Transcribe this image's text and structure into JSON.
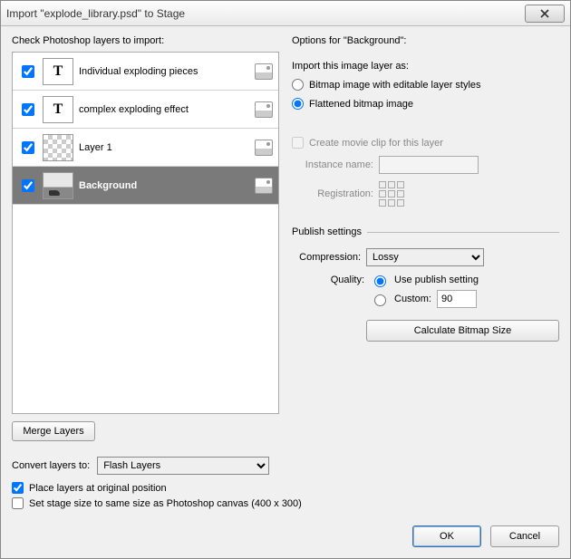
{
  "titlebar": {
    "title": "Import \"explode_library.psd\" to Stage"
  },
  "left": {
    "heading": "Check Photoshop layers to import:",
    "merge_label": "Merge Layers",
    "layers": [
      {
        "name": "Individual exploding pieces"
      },
      {
        "name": "complex exploding effect"
      },
      {
        "name": "Layer 1"
      },
      {
        "name": "Background"
      }
    ]
  },
  "right": {
    "heading": "Options for \"Background\":",
    "import_as_label": "Import this image layer as:",
    "radio_bitmap": "Bitmap image with editable layer styles",
    "radio_flattened": "Flattened bitmap image",
    "create_movieclip": "Create movie clip for this layer",
    "instance_label": "Instance name:",
    "registration_label": "Registration:",
    "publish_heading": "Publish settings",
    "compression_label": "Compression:",
    "compression_value": "Lossy",
    "quality_label": "Quality:",
    "quality_publish": "Use publish setting",
    "quality_custom": "Custom:",
    "quality_value": "90",
    "calc_button": "Calculate Bitmap Size"
  },
  "footer": {
    "convert_label": "Convert layers to:",
    "convert_value": "Flash Layers",
    "place_original": "Place layers at original position",
    "stage_size": "Set stage size to same size as Photoshop canvas (400 x 300)",
    "ok": "OK",
    "cancel": "Cancel"
  }
}
